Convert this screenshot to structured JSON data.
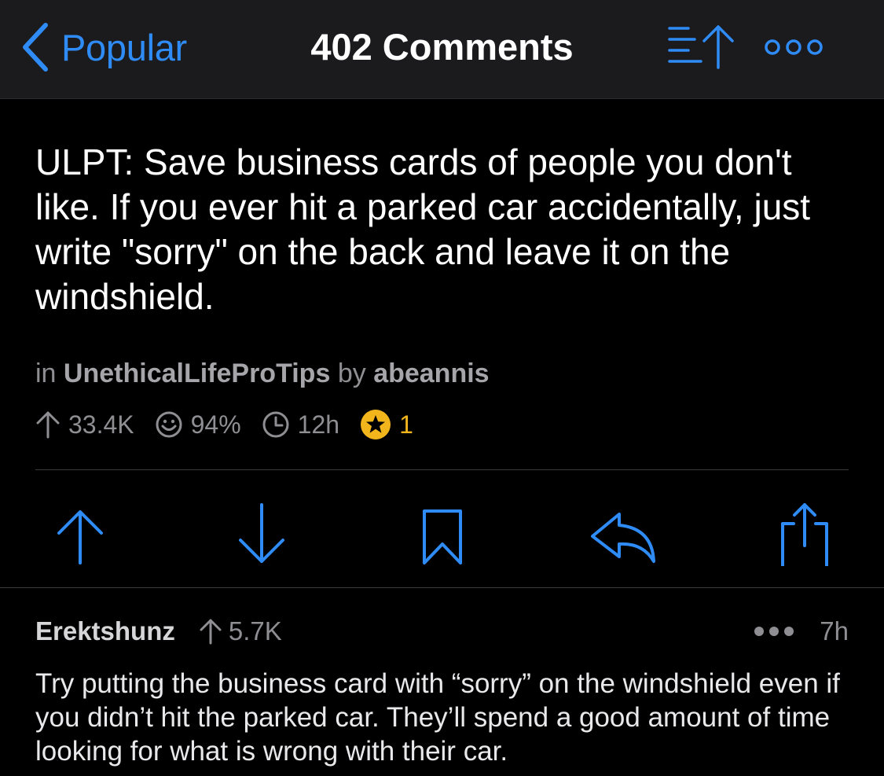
{
  "nav": {
    "back_label": "Popular",
    "title": "402 Comments",
    "sort_icon": "sort-up-icon",
    "more_icon": "more-circles-icon"
  },
  "post": {
    "title": "ULPT: Save business cards of people you don't like. If you ever hit a parked car accidentally, just write \"sorry\" on the back and leave it on the windshield.",
    "meta_in": "in",
    "subreddit": "UnethicalLifeProTips",
    "meta_by": "by",
    "author": "abeannis",
    "stats": {
      "score": "33.4K",
      "upvote_ratio": "94%",
      "age": "12h",
      "awards": "1"
    }
  },
  "actions": [
    "upvote-icon",
    "downvote-icon",
    "bookmark-icon",
    "reply-icon",
    "share-icon"
  ],
  "comment": {
    "author": "Erektshunz",
    "score": "5.7K",
    "age": "7h",
    "body": "Try putting the business card with “sorry” on the windshield even if you didn’t hit the parked car. They’ll spend a good amount of time looking for what is wrong with their car."
  },
  "colors": {
    "accent": "#2f8cf6",
    "background": "#000000",
    "navbar": "#1b1b1d",
    "muted": "#8e8e93",
    "gold": "#f2b51c"
  }
}
